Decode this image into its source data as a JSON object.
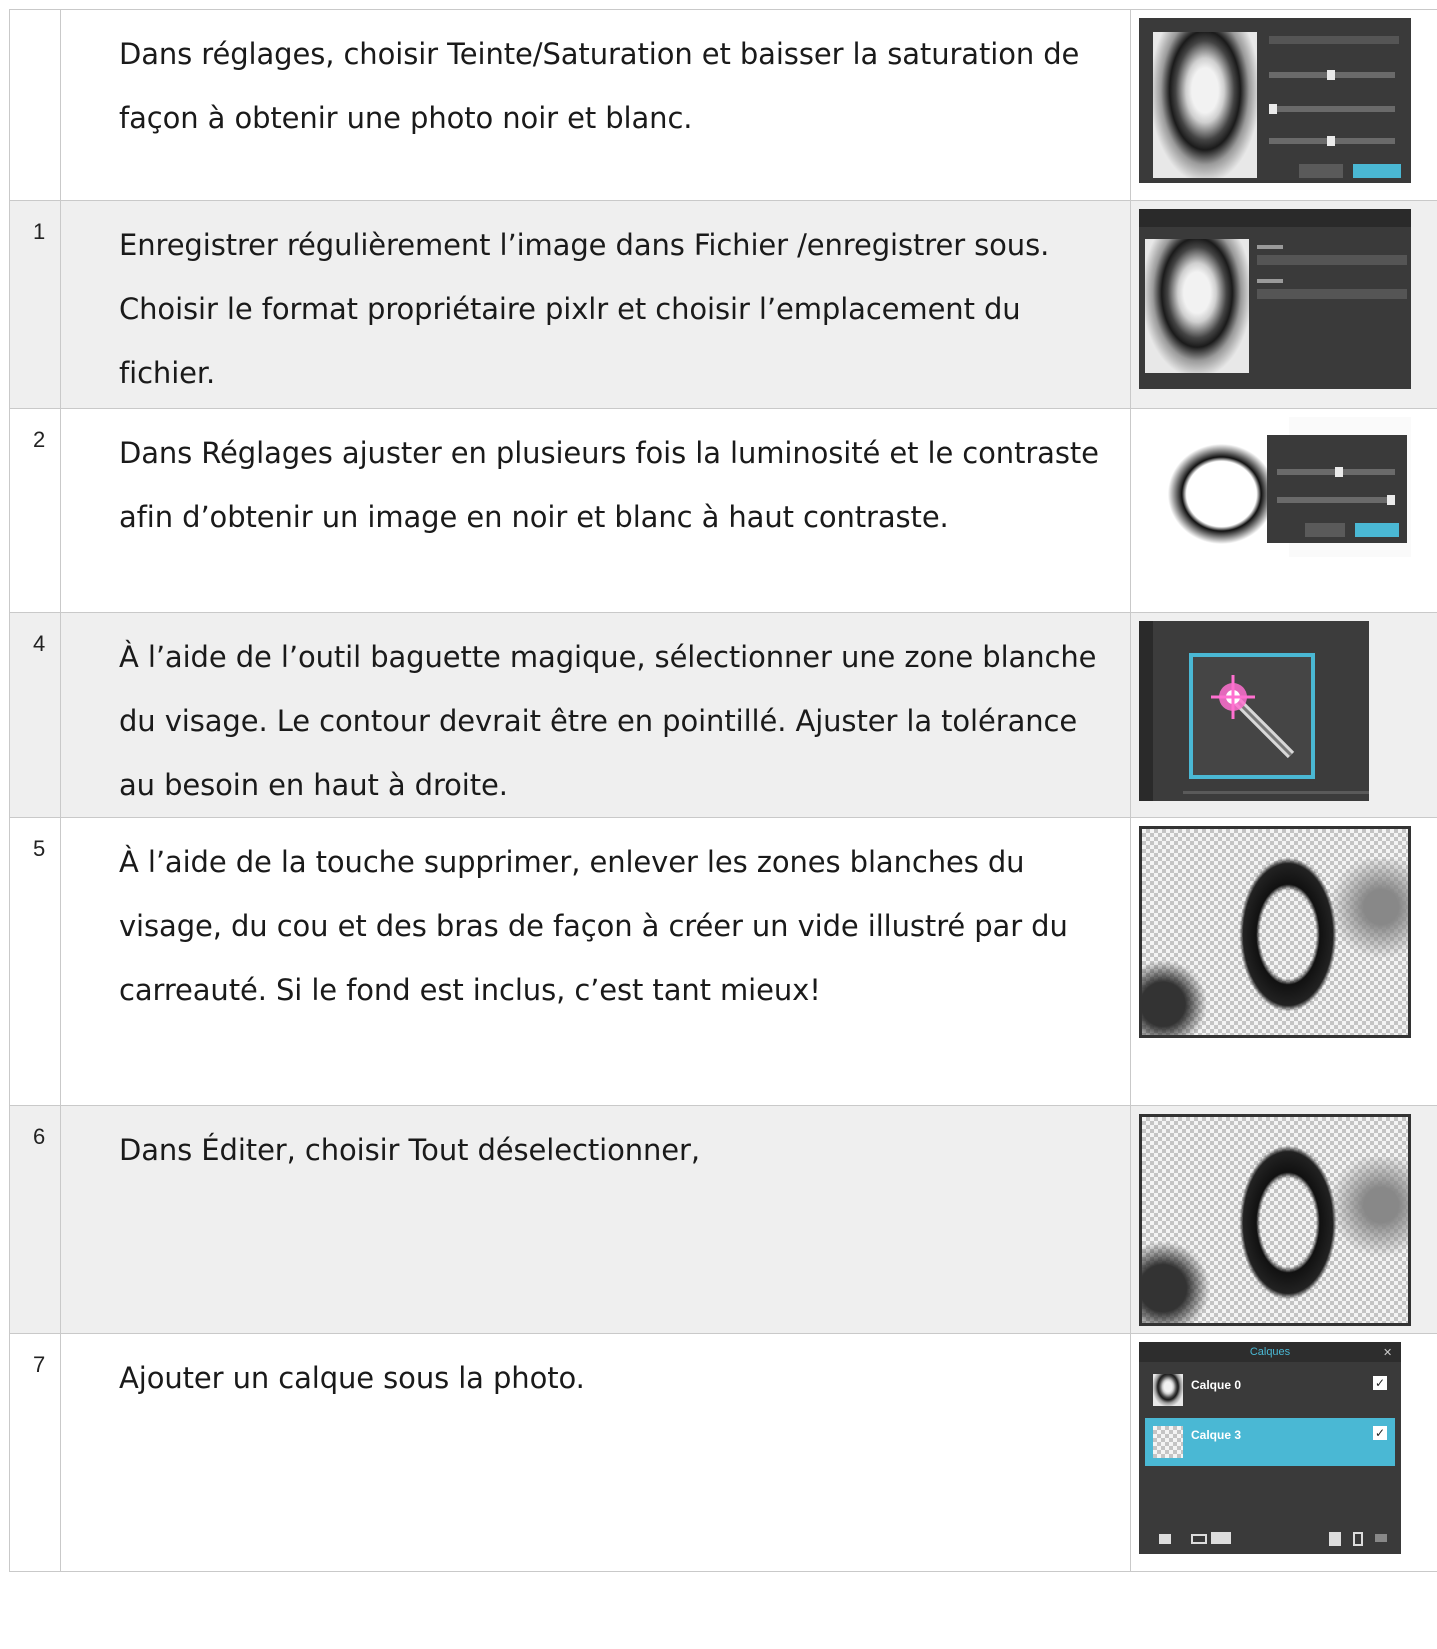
{
  "steps": [
    {
      "num": "",
      "text": "Dans réglages, choisir Teinte/Saturation et baisser la saturation de façon à obtenir une photo noir et blanc.",
      "thumb": "hue-saturation-dialog"
    },
    {
      "num": "1",
      "text": "Enregistrer régulièrement l’image dans Fichier /enregistrer sous. Choisir le format propriétaire pixlr et choisir l’emplacement du fichier.",
      "thumb": "save-image-dialog"
    },
    {
      "num": "2",
      "text": "Dans Réglages ajuster en plusieurs fois la luminosité et le contraste afin d’obtenir un image en noir et blanc à haut contraste.",
      "thumb": "brightness-contrast-dialog"
    },
    {
      "num": "4",
      "text": "À l’aide de l’outil baguette magique, sélectionner une zone blanche du visage. Le contour devrait être en pointillé. Ajuster la tolérance au besoin en haut à droite.",
      "thumb": "magic-wand-icon"
    },
    {
      "num": "5",
      "text": "À l’aide de la touche supprimer, enlever les zones blanches du visage, du cou et des bras de façon à créer un vide illustré par du carreauté. Si le fond est inclus, c’est tant mieux!",
      "thumb": "transparent-checker-photo"
    },
    {
      "num": "6",
      "text": "Dans Éditer, choisir Tout déselectionner,",
      "thumb": "transparent-checker-photo"
    },
    {
      "num": "7",
      "text": "Ajouter un calque sous la photo.",
      "thumb": "layers-panel"
    }
  ],
  "layers_panel": {
    "title": "Calques",
    "layer_top": "Calque 0",
    "layer_bottom": "Calque 3"
  },
  "colors": {
    "accent": "#4ab8d4",
    "row_shade": "#efefef",
    "grid": "#c9c9c9"
  }
}
